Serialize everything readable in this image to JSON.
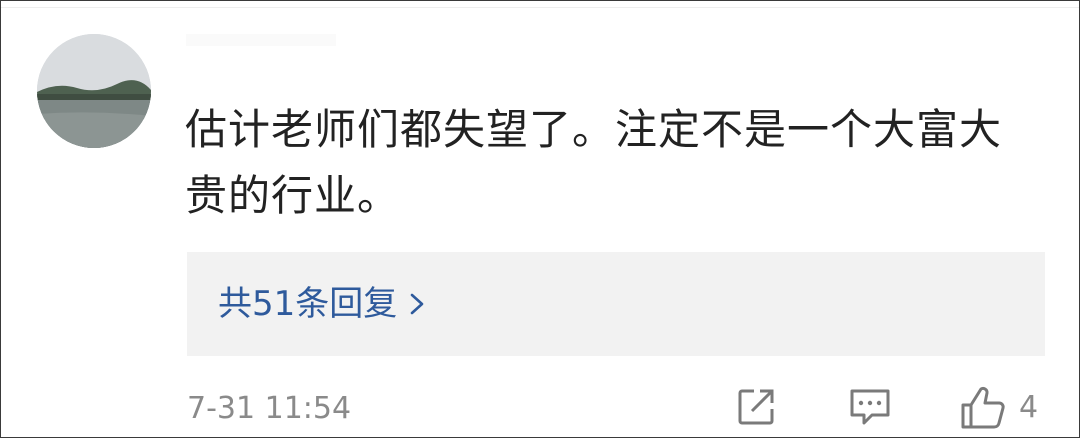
{
  "comment": {
    "text": "估计老师们都失望了。注定不是一个大富大贵的行业。"
  },
  "replies": {
    "label": "共51条回复"
  },
  "meta": {
    "timestamp": "7-31 11:54",
    "like_count": "4"
  },
  "icons": {
    "share": "share-icon",
    "reply": "comment-icon",
    "like": "thumbs-up-icon",
    "chevron": "chevron-right-icon"
  },
  "colors": {
    "link": "#2e5a9c",
    "text": "#222222",
    "muted": "#8a8a8a",
    "reply_bg": "#f2f2f2"
  }
}
